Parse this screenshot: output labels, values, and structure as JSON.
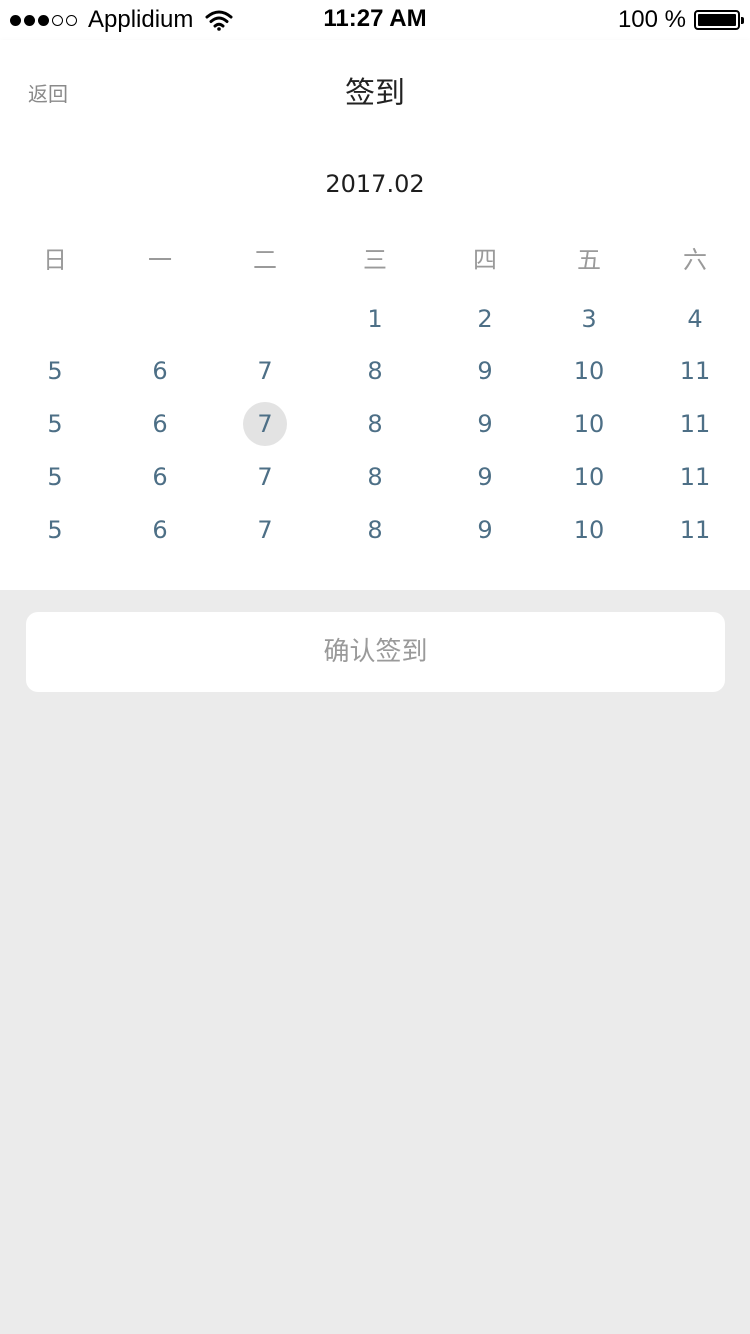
{
  "status_bar": {
    "carrier": "Applidium",
    "time": "11:27 AM",
    "battery_text": "100 %",
    "signal_filled": 3,
    "signal_total": 5
  },
  "nav": {
    "back_label": "返回",
    "title": "签到"
  },
  "calendar": {
    "month": "2017.02",
    "weekdays": [
      "日",
      "一",
      "二",
      "三",
      "四",
      "五",
      "六"
    ],
    "weeks": [
      [
        "",
        "",
        "",
        "1",
        "2",
        "3",
        "4"
      ],
      [
        "5",
        "6",
        "7",
        "8",
        "9",
        "10",
        "11"
      ],
      [
        "5",
        "6",
        "7",
        "8",
        "9",
        "10",
        "11"
      ],
      [
        "5",
        "6",
        "7",
        "8",
        "9",
        "10",
        "11"
      ],
      [
        "5",
        "6",
        "7",
        "8",
        "9",
        "10",
        "11"
      ]
    ],
    "selected": {
      "week": 2,
      "day": 2
    },
    "day_color": "#4d6f86",
    "selected_bg": "#e3e3e3"
  },
  "confirm": {
    "label": "确认签到"
  },
  "colors": {
    "page_bg": "#ebebeb",
    "card_bg": "#ffffff",
    "muted_text": "#9a9a9a"
  }
}
